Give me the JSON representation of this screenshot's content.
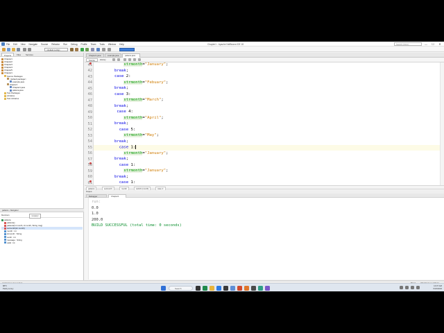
{
  "window": {
    "title": "Chapter1 - Apache NetBeans IDE 18",
    "menu": [
      "File",
      "Edit",
      "View",
      "Navigate",
      "Source",
      "Refactor",
      "Run",
      "Debug",
      "Profile",
      "Team",
      "Tools",
      "Window",
      "Help"
    ],
    "search_placeholder": "Search (Ctrl+I)",
    "controls": {
      "minimize": "—",
      "maximize": "☐",
      "close": "✕"
    }
  },
  "toolbar": {
    "config_value": "<default config>"
  },
  "projects_panel": {
    "tabs": [
      "Projects",
      "Files",
      "Services"
    ],
    "tree": [
      {
        "label": "Chapter1",
        "indent": 0,
        "icon": "coffee-cup-icon"
      },
      {
        "label": "Chapter2",
        "indent": 0,
        "icon": "coffee-cup-icon"
      },
      {
        "label": "Chapter3",
        "indent": 0,
        "icon": "coffee-cup-icon"
      },
      {
        "label": "Chapter4",
        "indent": 0,
        "icon": "coffee-cup-icon"
      },
      {
        "label": "Chapter5",
        "indent": 0,
        "icon": "coffee-cup-icon"
      },
      {
        "label": "Chapter1",
        "indent": 0,
        "icon": "coffee-cup-icon"
      },
      {
        "label": "Source Packages",
        "indent": 1,
        "icon": "folder-icon"
      },
      {
        "label": "<default package>",
        "indent": 2,
        "icon": "package-icon"
      },
      {
        "label": "example.java",
        "indent": 3,
        "icon": "java-file-icon"
      },
      {
        "label": "chapter1",
        "indent": 2,
        "icon": "package-icon"
      },
      {
        "label": "Chapter1.java",
        "indent": 3,
        "icon": "java-file-icon"
      },
      {
        "label": "palavra.java",
        "indent": 3,
        "icon": "java-file-icon"
      },
      {
        "label": "Test Packages",
        "indent": 1,
        "icon": "folder-icon"
      },
      {
        "label": "Libraries",
        "indent": 1,
        "icon": "folder-icon"
      },
      {
        "label": "Test Libraries",
        "indent": 1,
        "icon": "folder-icon"
      }
    ]
  },
  "navigator": {
    "header": "palavra - Navigator",
    "members_label": "Members",
    "members_select": "<empty>",
    "tree": [
      {
        "label": "palavra",
        "indent": 0,
        "icon": "class-icon",
        "selected": false
      },
      {
        "label": "palavra()",
        "indent": 1,
        "icon": "method-icon",
        "selected": false
      },
      {
        "label": "palavra(int month, int centh, String msg)",
        "indent": 1,
        "icon": "method-icon",
        "selected": false
      },
      {
        "label": "setmonth(int month)",
        "indent": 1,
        "icon": "method-icon",
        "selected": true
      },
      {
        "label": "month : int",
        "indent": 1,
        "icon": "field-icon",
        "selected": false
      },
      {
        "label": "strmonth : String",
        "indent": 1,
        "icon": "field-icon",
        "selected": false
      },
      {
        "label": "centh : int",
        "indent": 1,
        "icon": "field-icon",
        "selected": false
      },
      {
        "label": "message : String",
        "indent": 1,
        "icon": "field-icon",
        "selected": false
      },
      {
        "label": "valid : int",
        "indent": 1,
        "icon": "field-icon",
        "selected": false
      }
    ]
  },
  "editor": {
    "tabs": [
      "Chapter1.java",
      "example.java",
      "palavra.java"
    ],
    "active_tab_index": 2,
    "source_tabs": [
      "Source",
      "History"
    ],
    "lines": [
      {
        "n": "41",
        "indent": "            ",
        "tokens": [
          {
            "t": "strmonth",
            "c": "var"
          },
          {
            "t": "=",
            "c": ""
          },
          {
            "t": "\"January\"",
            "c": "str"
          },
          {
            "t": ";",
            "c": ""
          }
        ]
      },
      {
        "n": "42",
        "indent": "        ",
        "tokens": [
          {
            "t": "break",
            "c": "kw"
          },
          {
            "t": ";",
            "c": ""
          }
        ]
      },
      {
        "n": "43",
        "indent": "        ",
        "tokens": [
          {
            "t": "case",
            "c": "kw"
          },
          {
            "t": " 2:",
            "c": ""
          }
        ]
      },
      {
        "n": "44",
        "indent": "            ",
        "tokens": [
          {
            "t": "strmonth",
            "c": "var"
          },
          {
            "t": "=",
            "c": ""
          },
          {
            "t": "\"Febuary\"",
            "c": "str"
          },
          {
            "t": ";",
            "c": ""
          }
        ]
      },
      {
        "n": "45",
        "indent": "        ",
        "tokens": [
          {
            "t": "break",
            "c": "kw"
          },
          {
            "t": ";",
            "c": ""
          }
        ]
      },
      {
        "n": "46",
        "indent": "        ",
        "tokens": [
          {
            "t": "case",
            "c": "kw"
          },
          {
            "t": " 3:",
            "c": ""
          }
        ]
      },
      {
        "n": "47",
        "indent": "            ",
        "tokens": [
          {
            "t": "strmonth",
            "c": "var"
          },
          {
            "t": "=",
            "c": ""
          },
          {
            "t": "\"March\"",
            "c": "str"
          },
          {
            "t": ";",
            "c": ""
          }
        ]
      },
      {
        "n": "48",
        "indent": "        ",
        "tokens": [
          {
            "t": "break",
            "c": "kw"
          },
          {
            "t": ";",
            "c": ""
          }
        ]
      },
      {
        "n": "49",
        "indent": "         ",
        "tokens": [
          {
            "t": "case",
            "c": "kw"
          },
          {
            "t": " 4:",
            "c": ""
          }
        ]
      },
      {
        "n": "50",
        "indent": "            ",
        "tokens": [
          {
            "t": "strmonth",
            "c": "var"
          },
          {
            "t": "=",
            "c": ""
          },
          {
            "t": "\"April\"",
            "c": "str"
          },
          {
            "t": ";",
            "c": ""
          }
        ]
      },
      {
        "n": "51",
        "indent": "        ",
        "tokens": [
          {
            "t": "break",
            "c": "kw"
          },
          {
            "t": ";",
            "c": ""
          }
        ]
      },
      {
        "n": "52",
        "indent": "          ",
        "tokens": [
          {
            "t": "case",
            "c": "kw"
          },
          {
            "t": " 5:",
            "c": ""
          }
        ]
      },
      {
        "n": "53",
        "indent": "            ",
        "tokens": [
          {
            "t": "strmonth",
            "c": "var"
          },
          {
            "t": "=",
            "c": ""
          },
          {
            "t": "\"May\"",
            "c": "str"
          },
          {
            "t": ";",
            "c": ""
          }
        ]
      },
      {
        "n": "54",
        "indent": "        ",
        "tokens": [
          {
            "t": "break",
            "c": "kw"
          },
          {
            "t": ";",
            "c": ""
          }
        ]
      },
      {
        "n": "55",
        "indent": "          ",
        "tokens": [
          {
            "t": "case",
            "c": "kw"
          },
          {
            "t": " 1:",
            "c": ""
          }
        ],
        "current": true
      },
      {
        "n": "56",
        "indent": "            ",
        "tokens": [
          {
            "t": "strmonth",
            "c": "var"
          },
          {
            "t": "=",
            "c": ""
          },
          {
            "t": "\"January\"",
            "c": "str"
          },
          {
            "t": ";",
            "c": ""
          }
        ]
      },
      {
        "n": "57",
        "indent": "        ",
        "tokens": [
          {
            "t": "break",
            "c": "kw"
          },
          {
            "t": ";",
            "c": ""
          }
        ]
      },
      {
        "n": "58",
        "indent": "          ",
        "tokens": [
          {
            "t": "case",
            "c": "kw"
          },
          {
            "t": " 1:",
            "c": ""
          }
        ]
      },
      {
        "n": "59",
        "indent": "            ",
        "tokens": [
          {
            "t": "strmonth",
            "c": "var"
          },
          {
            "t": "=",
            "c": ""
          },
          {
            "t": "\"January\"",
            "c": "str"
          },
          {
            "t": ";",
            "c": ""
          }
        ]
      },
      {
        "n": "60",
        "indent": "        ",
        "tokens": [
          {
            "t": "break",
            "c": "kw"
          },
          {
            "t": ";",
            "c": ""
          }
        ]
      },
      {
        "n": "61",
        "indent": "          ",
        "tokens": [
          {
            "t": "case",
            "c": "kw"
          },
          {
            "t": " 1:",
            "c": ""
          }
        ]
      }
    ],
    "breadcrumbs": [
      "palavra",
      "setmonth",
      "month",
      "switch (month)",
      "case 1:"
    ]
  },
  "output": {
    "header": "Output",
    "tabs": [
      "Debugger Console",
      "Chapter1 (run)"
    ],
    "active_tab_index": 1,
    "lines": [
      {
        "text": "run:",
        "kind": "faint"
      },
      {
        "text": "0.0",
        "kind": ""
      },
      {
        "text": "1.0",
        "kind": ""
      },
      {
        "text": "200.0",
        "kind": ""
      },
      {
        "text": "BUILD SUCCESSFUL (total time: 0 seconds)",
        "kind": "ok"
      }
    ]
  },
  "statusbar": {
    "left": "Application Uncompiled",
    "position": "55:13",
    "mode": "INS  Windows (CRLF)"
  },
  "taskbar": {
    "weather_temp": "88°F",
    "weather_desc": "Partly sunny",
    "search_label": "Search",
    "time": "10:37 AM",
    "date": "6/23/2023"
  },
  "colors": {
    "keyword": "#0000e6",
    "string": "#ce7b00",
    "variable": "#009900",
    "success": "#0b8f2e"
  }
}
